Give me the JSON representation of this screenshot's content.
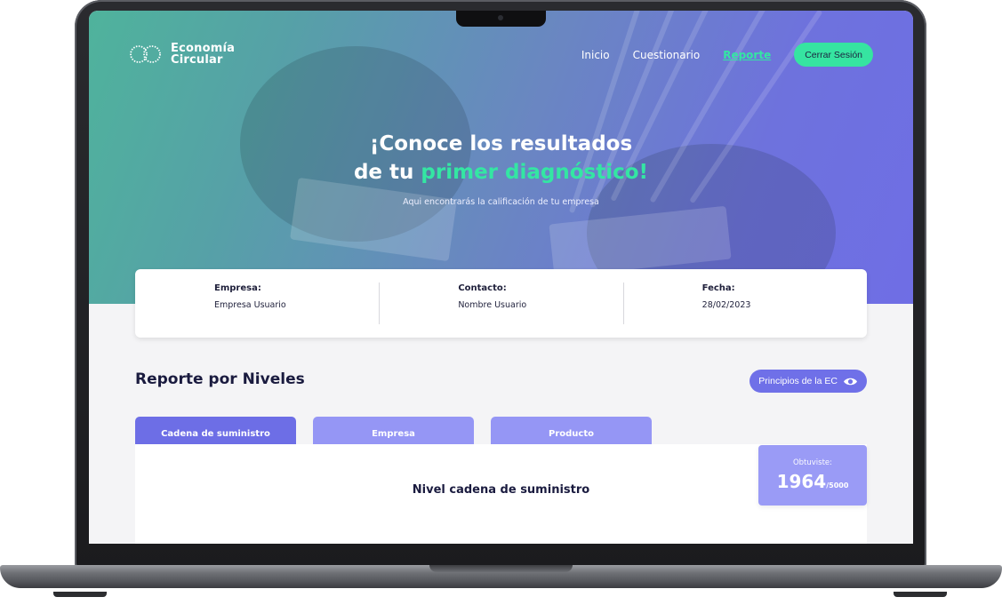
{
  "brand": {
    "line1": "Economía",
    "line2": "Circular"
  },
  "nav": {
    "items": [
      "Inicio",
      "Cuestionario",
      "Reporte"
    ],
    "active": "Reporte",
    "logout_label": "Cerrar Sesión"
  },
  "hero": {
    "title_line1": "¡Conoce los resultados",
    "title_line2_prefix": "de tu ",
    "title_line2_highlight": "primer diagnóstico!",
    "subtitle": "Aqui encontrarás la calificación de tu empresa"
  },
  "info": {
    "company_label": "Empresa:",
    "company_value": "Empresa Usuario",
    "contact_label": "Contacto:",
    "contact_value": "Nombre Usuario",
    "date_label": "Fecha:",
    "date_value": "28/02/2023"
  },
  "report": {
    "title": "Reporte por Niveles",
    "principles_label": "Principios de la EC",
    "tabs": [
      "Cadena de suministro",
      "Empresa",
      "Producto"
    ],
    "active_tab": "Cadena de suministro",
    "panel_title": "Nivel cadena de suministro",
    "score_caption": "Obtuviste:",
    "score_value": "1964",
    "score_total": "/5000"
  },
  "colors": {
    "accent_green": "#34e6a3",
    "accent_purple": "#6f70e8",
    "tab_inactive": "#9596f5",
    "text_dark": "#1a1b3f"
  },
  "icons": {
    "eye": "eye-icon",
    "logo": "circular-logo-icon"
  }
}
